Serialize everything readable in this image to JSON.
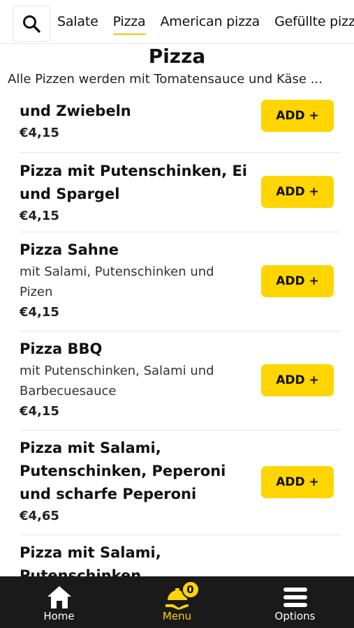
{
  "colors": {
    "accent": "#ffd500",
    "nav_bg": "#1a1a1a"
  },
  "categories": [
    {
      "label": "Salate",
      "active": false
    },
    {
      "label": "Pizza",
      "active": true
    },
    {
      "label": "American pizza",
      "active": false
    },
    {
      "label": "Gefüllte pizza",
      "active": false
    }
  ],
  "section": {
    "title": "Pizza",
    "description": "Alle Pizzen werden mit Tomatensauce und Käse ..."
  },
  "add_label": "ADD +",
  "items": [
    {
      "name": "und Zwiebeln",
      "description": "",
      "price": "€4,15"
    },
    {
      "name": "Pizza mit Putenschinken, Ei und Spargel",
      "description": "",
      "price": "€4,15"
    },
    {
      "name": "Pizza Sahne",
      "description": "mit Salami, Putenschinken und Pizen",
      "price": "€4,15"
    },
    {
      "name": "Pizza BBQ",
      "description": "mit Putenschinken, Salami und Barbecuesauce",
      "price": "€4,15"
    },
    {
      "name": "Pizza mit Salami, Putenschinken, Peperoni und scharfe Peperoni",
      "description": "",
      "price": "€4,65"
    },
    {
      "name": "Pizza mit Salami, Putenschinken, Champignons",
      "description": "",
      "price": ""
    }
  ],
  "nav": {
    "home": "Home",
    "menu": "Menu",
    "cart_count": "0",
    "options": "Options"
  }
}
